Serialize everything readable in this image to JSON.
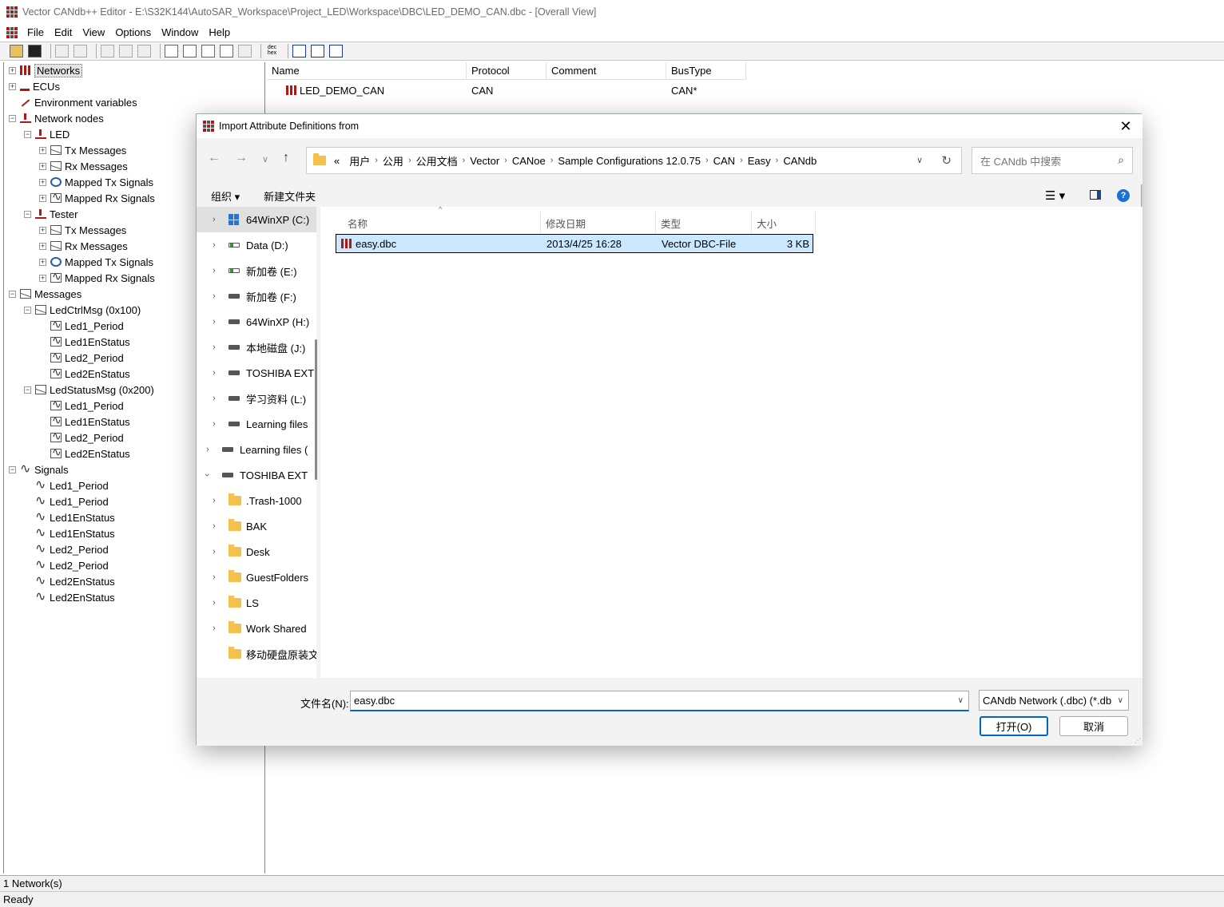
{
  "window": {
    "title": "Vector CANdb++ Editor - E:\\S32K144\\AutoSAR_Workspace\\Project_LED\\Workspace\\DBC\\LED_DEMO_CAN.dbc - [Overall View]"
  },
  "menu": [
    "File",
    "Edit",
    "View",
    "Options",
    "Window",
    "Help"
  ],
  "tree": {
    "networks": "Networks",
    "ecus": "ECUs",
    "env": "Environment variables",
    "nodes": "Network nodes",
    "led": "LED",
    "tx_messages": "Tx Messages",
    "rx_messages": "Rx Messages",
    "mapped_tx": "Mapped Tx Signals",
    "mapped_rx": "Mapped Rx Signals",
    "tester": "Tester",
    "messages": "Messages",
    "ledctrl": "LedCtrlMsg (0x100)",
    "ledstatus": "LedStatusMsg (0x200)",
    "led1_period": "Led1_Period",
    "led1_en": "Led1EnStatus",
    "led2_period": "Led2_Period",
    "led2_en": "Led2EnStatus",
    "signals": "Signals"
  },
  "table": {
    "headers": [
      "Name",
      "Protocol",
      "Comment",
      "BusType"
    ],
    "row": {
      "name": "LED_DEMO_CAN",
      "protocol": "CAN",
      "comment": "",
      "bustype": "CAN*"
    }
  },
  "status": {
    "line1": "1 Network(s)",
    "line2": "Ready"
  },
  "dialog": {
    "title": "Import Attribute Definitions from",
    "breadcrumb": [
      "«",
      "用户",
      "公用",
      "公用文档",
      "Vector",
      "CANoe",
      "Sample Configurations 12.0.75",
      "CAN",
      "Easy",
      "CANdb"
    ],
    "search_placeholder": "在 CANdb 中搜索",
    "organize": "组织",
    "new_folder": "新建文件夹",
    "nav": {
      "c": "64WinXP  (C:)",
      "d": "Data (D:)",
      "e": "新加卷 (E:)",
      "f": "新加卷 (F:)",
      "h": "64WinXP  (H:)",
      "j": "本地磁盘 (J:)",
      "k": "TOSHIBA EXT",
      "l": "学习资料 (L:)",
      "m": "Learning files",
      "n": "Learning files (",
      "o": "TOSHIBA EXT",
      "f1": ".Trash-1000",
      "f2": "BAK",
      "f3": "Desk",
      "f4": "GuestFolders",
      "f5": "LS",
      "f6": "Work Shared",
      "f7": "移动硬盘原装文"
    },
    "columns": [
      "名称",
      "修改日期",
      "类型",
      "大小"
    ],
    "file": {
      "name": "easy.dbc",
      "date": "2013/4/25 16:28",
      "type": "Vector DBC-File",
      "size": "3 KB"
    },
    "filename_label": "文件名(N):",
    "filename_value": "easy.dbc",
    "filetype": "CANdb Network (.dbc) (*.db",
    "open": "打开(O)",
    "cancel": "取消"
  },
  "colors": {
    "accent": "#0067c0",
    "brand": "#b01818",
    "selection": "#cce8ff"
  }
}
